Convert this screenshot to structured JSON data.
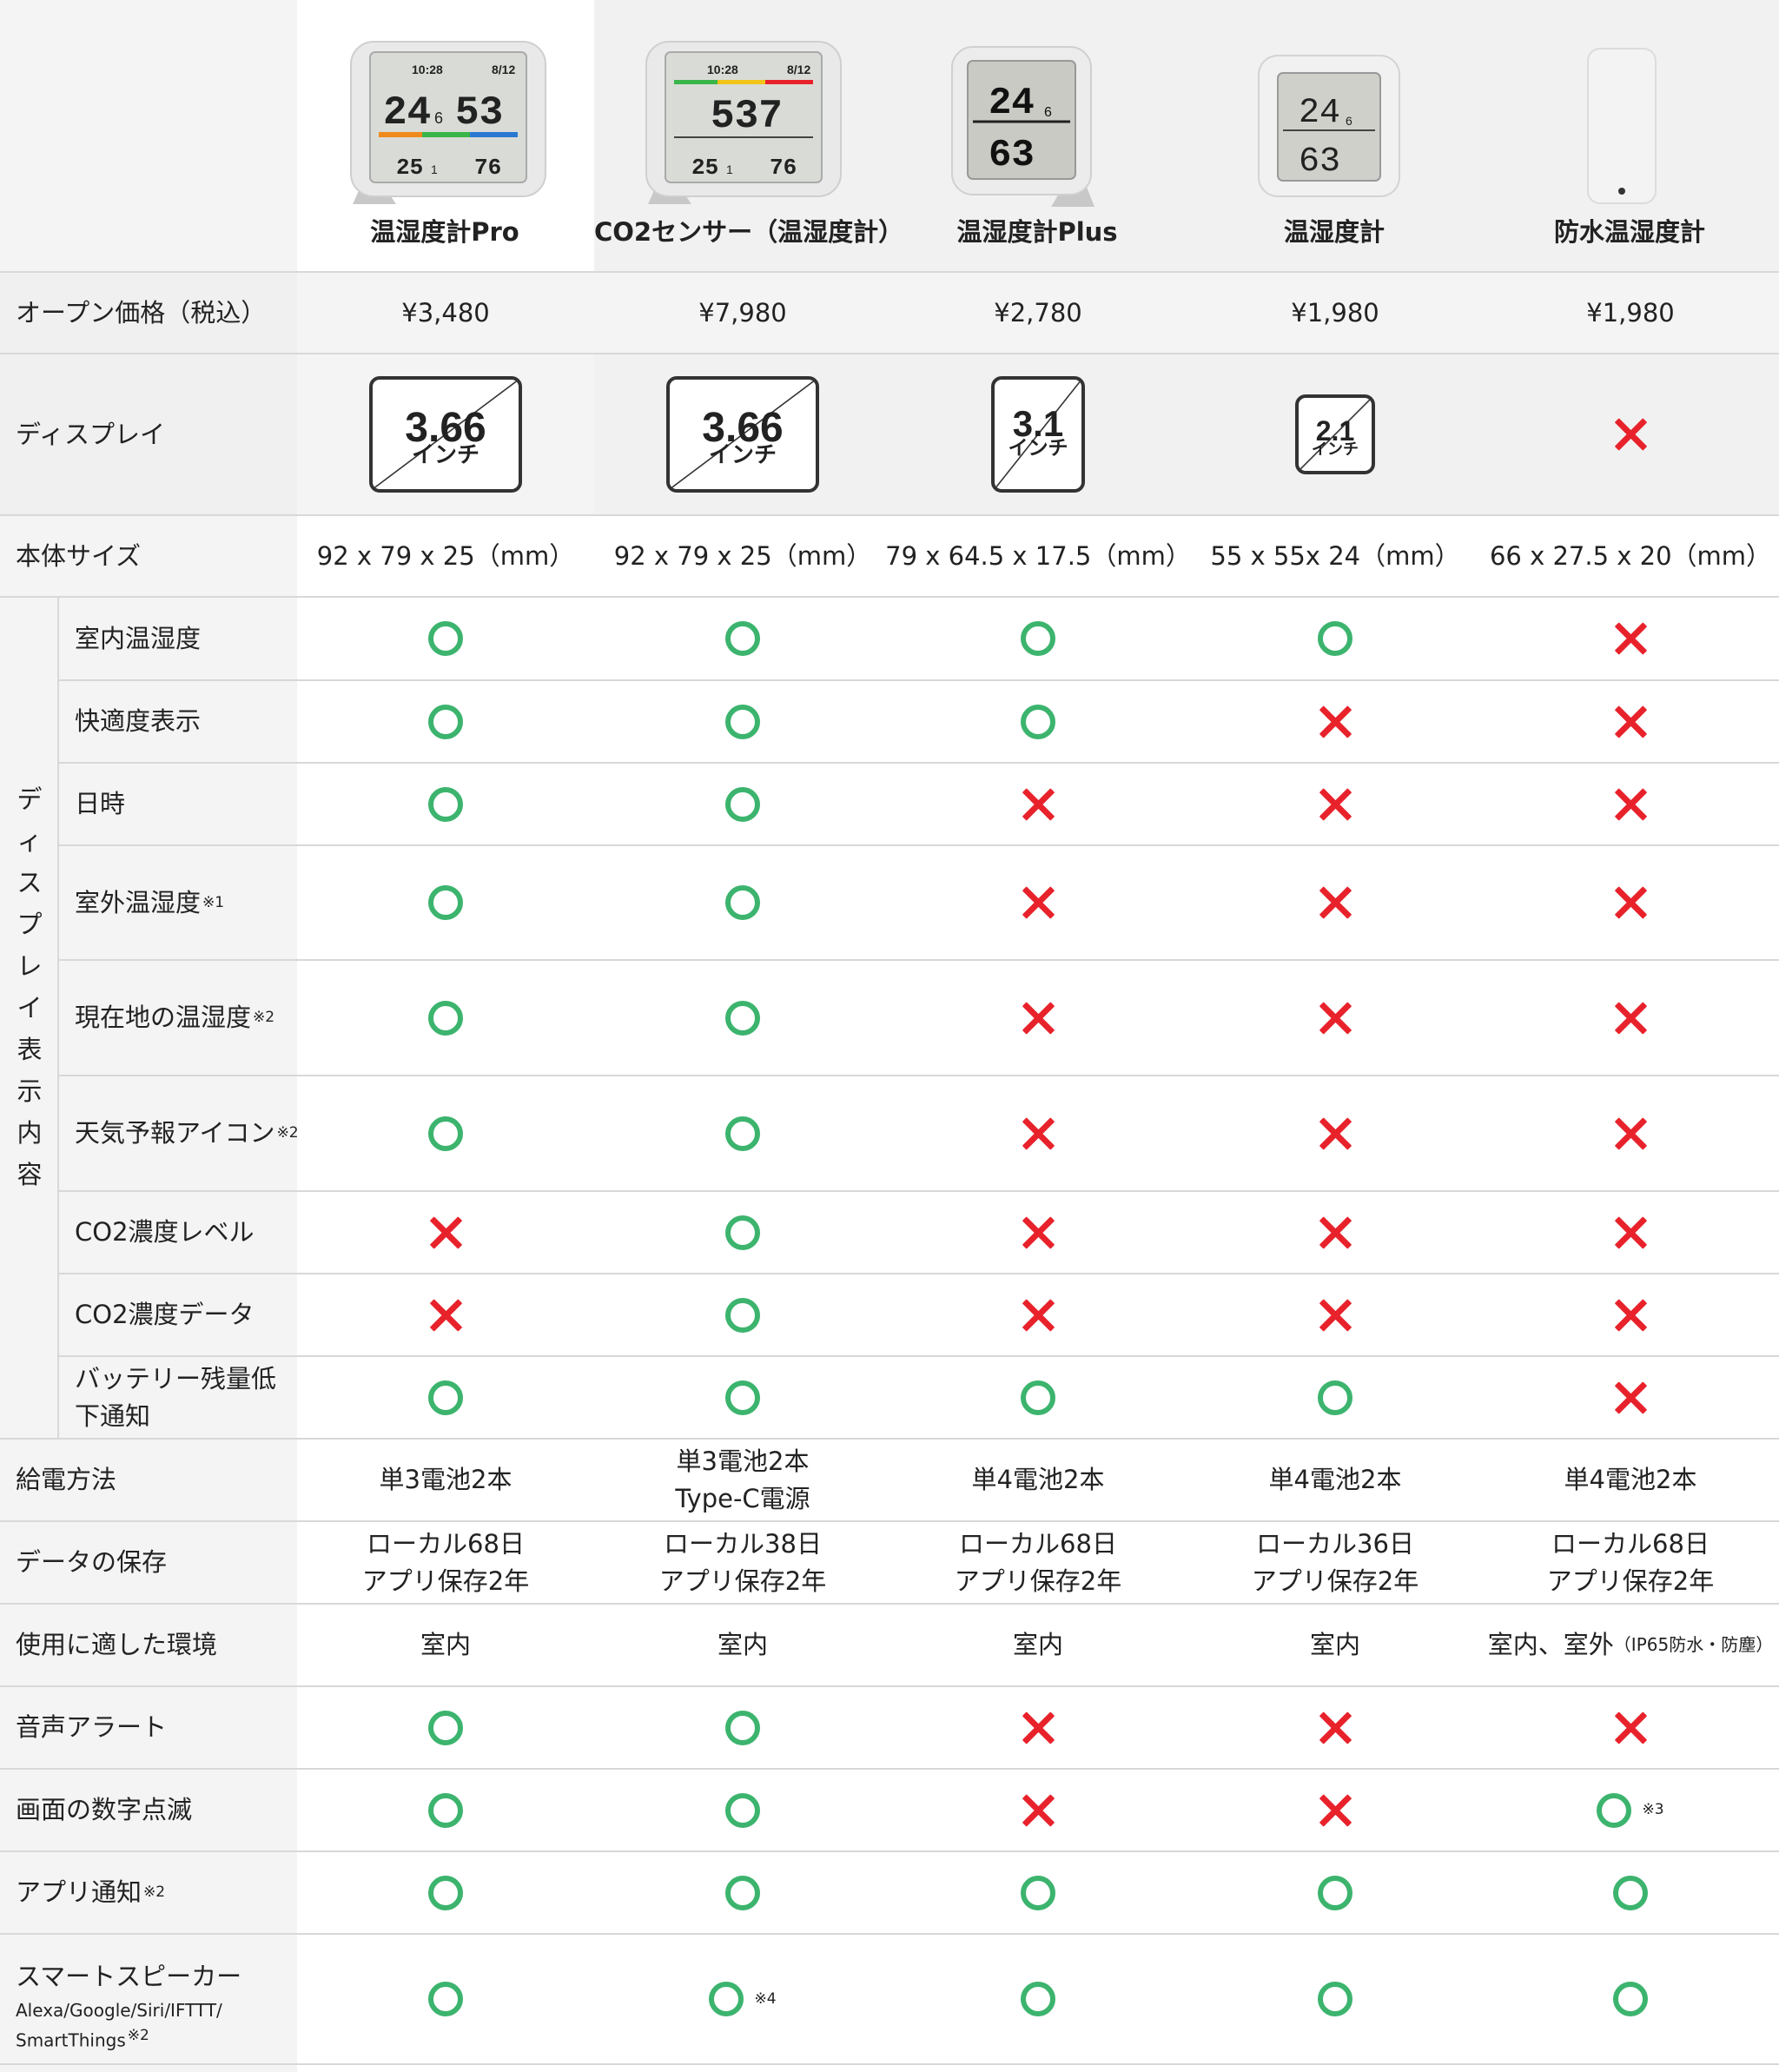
{
  "products": [
    {
      "name": "温湿度計Pro",
      "price": "¥3,480",
      "display_value": "3.66",
      "display_unit": "インチ",
      "size": "92 x 79 x 25（mm）",
      "power": [
        "単3電池2本"
      ],
      "storage": [
        "ローカル68日",
        "アプリ保存2年"
      ],
      "environment": "室内",
      "environment_note": ""
    },
    {
      "name": "CO2センサー（温湿度計）",
      "price": "¥7,980",
      "display_value": "3.66",
      "display_unit": "インチ",
      "size": "92 x 79 x 25（mm）",
      "power": [
        "単3電池2本",
        "Type-C電源"
      ],
      "storage": [
        "ローカル38日",
        "アプリ保存2年"
      ],
      "environment": "室内",
      "environment_note": ""
    },
    {
      "name": "温湿度計Plus",
      "price": "¥2,780",
      "display_value": "3.1",
      "display_unit": "インチ",
      "size": "79 x 64.5 x 17.5（mm）",
      "power": [
        "単4電池2本"
      ],
      "storage": [
        "ローカル68日",
        "アプリ保存2年"
      ],
      "environment": "室内",
      "environment_note": ""
    },
    {
      "name": "温湿度計",
      "price": "¥1,980",
      "display_value": "2.1",
      "display_unit": "インチ",
      "size": "55 x 55x 24（mm）",
      "power": [
        "単4電池2本"
      ],
      "storage": [
        "ローカル36日",
        "アプリ保存2年"
      ],
      "environment": "室内",
      "environment_note": ""
    },
    {
      "name": "防水温湿度計",
      "price": "¥1,980",
      "display_value": "",
      "display_unit": "",
      "size": "66 x 27.5 x 20（mm）",
      "power": [
        "単4電池2本"
      ],
      "storage": [
        "ローカル68日",
        "アプリ保存2年"
      ],
      "environment": "室内、室外",
      "environment_note": "（IP65防水・防塵）"
    }
  ],
  "labels": {
    "price": "オープン価格（税込）",
    "display": "ディスプレイ",
    "size": "本体サイズ",
    "display_contents_group": "ディスプレイ表示内容",
    "power": "給電方法",
    "storage": "データの保存",
    "environment": "使用に適した環境",
    "voice_alert": "音声アラート",
    "blink": "画面の数字点滅",
    "app_notify": "アプリ通知",
    "app_notify_note": "※2",
    "smart_speaker": "スマートスピーカー",
    "smart_speaker_sub1": "Alexa/Google/Siri/IFTTT/",
    "smart_speaker_sub2": "SmartThings",
    "smart_speaker_note": "※2"
  },
  "display_features": [
    {
      "label": "室内温湿度",
      "note": "",
      "values": [
        "o",
        "o",
        "o",
        "o",
        "x"
      ]
    },
    {
      "label": "快適度表示",
      "note": "",
      "values": [
        "o",
        "o",
        "o",
        "x",
        "x"
      ]
    },
    {
      "label": "日時",
      "note": "",
      "values": [
        "o",
        "o",
        "x",
        "x",
        "x"
      ]
    },
    {
      "label": "室外温湿度",
      "note": "※1",
      "values": [
        "o",
        "o",
        "x",
        "x",
        "x"
      ]
    },
    {
      "label": "現在地の温湿度",
      "note": "※2",
      "values": [
        "o",
        "o",
        "x",
        "x",
        "x"
      ]
    },
    {
      "label": "天気予報アイコン",
      "note": "※2",
      "values": [
        "o",
        "o",
        "x",
        "x",
        "x"
      ]
    },
    {
      "label": "CO2濃度レベル",
      "note": "",
      "values": [
        "x",
        "o",
        "x",
        "x",
        "x"
      ]
    },
    {
      "label": "CO2濃度データ",
      "note": "",
      "values": [
        "x",
        "o",
        "x",
        "x",
        "x"
      ]
    },
    {
      "label": "バッテリー残量低下通知",
      "label_line1": "バッテリー残量低",
      "label_line2": "下通知",
      "note": "",
      "values": [
        "o",
        "o",
        "o",
        "o",
        "x"
      ]
    }
  ],
  "voice_alert": [
    "o",
    "o",
    "x",
    "x",
    "x"
  ],
  "blink": [
    "o",
    "o",
    "x",
    "x",
    "o"
  ],
  "blink_notes": [
    "",
    "",
    "",
    "",
    "※3"
  ],
  "app_notify": [
    "o",
    "o",
    "o",
    "o",
    "o"
  ],
  "smart_speaker": [
    "o",
    "o",
    "o",
    "o",
    "o"
  ],
  "smart_speaker_notes": [
    "",
    "※4",
    "",
    "",
    ""
  ],
  "device_screens": {
    "pro": {
      "time": "10:28",
      "date": "8/12",
      "temp": "24",
      "temp_dec": "6",
      "hum": "53",
      "out_temp": "25",
      "out_temp_dec": "1",
      "out_hum": "76"
    },
    "co2": {
      "time": "10:28",
      "date": "8/12",
      "co2": "537",
      "out_temp": "25",
      "out_temp_dec": "1",
      "out_hum": "76"
    },
    "plus": {
      "temp": "24",
      "temp_dec": "6",
      "hum": "63"
    },
    "basic": {
      "temp": "24",
      "temp_dec": "6",
      "hum": "63"
    }
  },
  "colors": {
    "ok": "#3cb46e",
    "ng": "#e8222b",
    "label_bg": "#f4f4f4",
    "grid": "#d8d8d8"
  }
}
